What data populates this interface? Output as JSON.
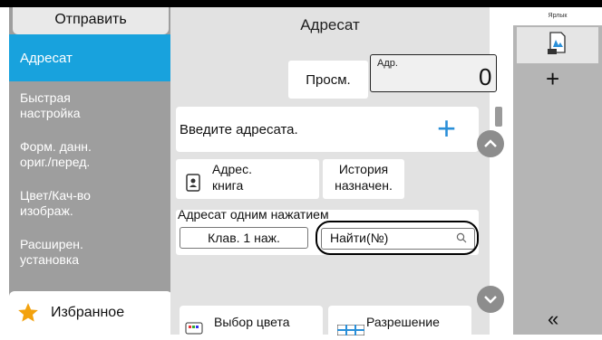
{
  "left": {
    "send": "Отправить",
    "items": [
      {
        "label1": "Адресат",
        "label2": ""
      },
      {
        "label1": "Быстрая",
        "label2": "настройка"
      },
      {
        "label1": "Форм. данн.",
        "label2": "ориг./перед."
      },
      {
        "label1": "Цвет/Кач-во",
        "label2": "изображ."
      },
      {
        "label1": "Расширен.",
        "label2": "установка"
      }
    ],
    "favorites": "Избранное"
  },
  "main": {
    "title": "Адресат",
    "view": "Просм.",
    "count_label": "Адр.",
    "count": "0",
    "entry": "Введите адресата.",
    "addr_book_1": "Адрес.",
    "addr_book_2": "книга",
    "history_1": "История",
    "history_2": "назначен.",
    "one_touch_title": "Адресат одним нажатием",
    "one_touch_key": "Клав. 1 наж.",
    "find": "Найти(№)",
    "color_select": "Выбор цвета",
    "resolution": "Разрешение"
  },
  "right": {
    "label_tab": "Ярлык",
    "collapse": "«"
  },
  "colors": {
    "accent": "#18a2dd",
    "plus": "#2a8fd8",
    "sidebar": "#9e9e9e",
    "star": "#f3a20e"
  }
}
